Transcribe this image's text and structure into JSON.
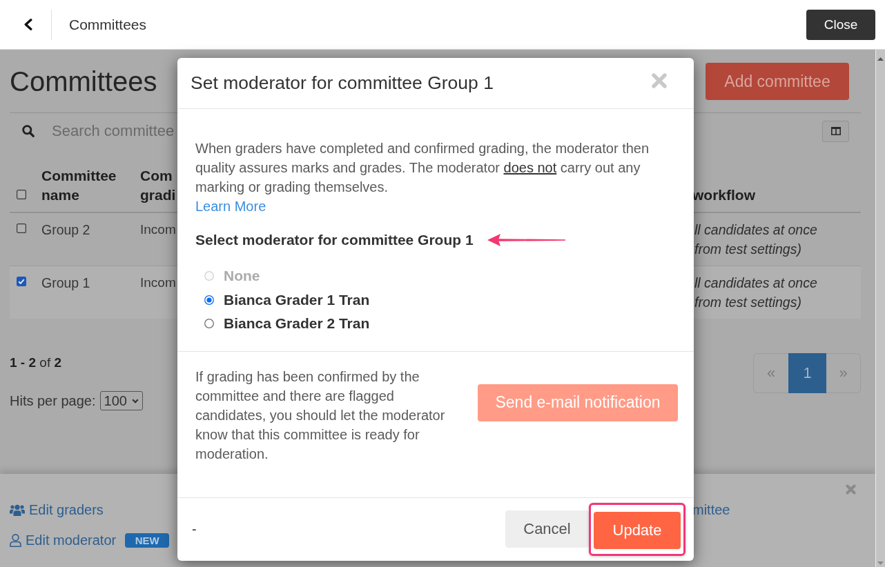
{
  "top_bar": {
    "title": "Committees",
    "close_button": "Close"
  },
  "page": {
    "heading": "Committees",
    "add_button": "Add committee",
    "search": {
      "placeholder": "Search committee"
    },
    "table": {
      "select_all": {
        "checked": false
      },
      "columns": [
        "Committee name",
        "Com gradi",
        "workflow"
      ],
      "rows": [
        {
          "checked": false,
          "cells": [
            "Group 2",
            "Incom",
            "ll candidates at once from test settings)"
          ]
        },
        {
          "checked": true,
          "cells": [
            "Group 1",
            "Incom",
            "ll candidates at once from test settings)"
          ]
        }
      ]
    },
    "summary": "**1 - 2** of **2**",
    "hits_per_page": {
      "label": "Hits per page:",
      "value": "100"
    },
    "pagination": {
      "previous": "«",
      "pages": [
        {
          "label": "1",
          "selected": true
        }
      ],
      "next": "»"
    },
    "action_panel": {
      "actions": [
        {
          "label": "Edit graders"
        },
        {
          "label": "Edit moderator",
          "badge": "NEW"
        }
      ],
      "side_actions": [
        {
          "label": "mittee"
        }
      ]
    }
  },
  "dialog": {
    "title": "Set moderator for committee Group 1",
    "intro": [
      {
        "text": "When graders have completed and confirmed grading, the moderator then quality assures marks and grades. The moderator ",
        "underlined": false
      },
      {
        "text": "does not",
        "underlined": true
      },
      {
        "text": " carry out any marking or grading themselves.",
        "underlined": false
      }
    ],
    "learn_more": "Learn More",
    "select_label": {
      "text": "Select moderator for committee Group 1",
      "pointed_at": true
    },
    "options": [
      {
        "label": "None",
        "selected": false,
        "disabled": true
      },
      {
        "label": "Bianca Grader 1 Tran",
        "selected": true,
        "disabled": false
      },
      {
        "label": "Bianca Grader 2 Tran",
        "selected": false,
        "disabled": false
      }
    ],
    "notice": "If grading has been confirmed by the committee and there are flagged candidates, you should let the moderator know that this committee is ready for moderation.",
    "notify_button": {
      "label": "Send e-mail notification",
      "disabled": true
    },
    "footer_text": "-",
    "cancel_button": "Cancel",
    "update_button": {
      "label": "Update",
      "highlighted": true
    }
  }
}
